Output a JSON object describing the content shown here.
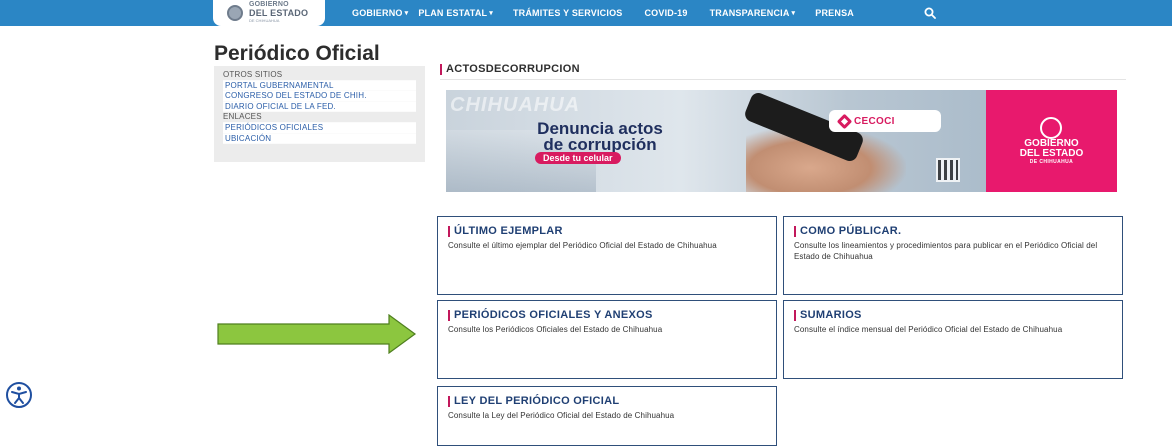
{
  "header": {
    "logo": {
      "line1": "GOBIERNO",
      "line2": "DEL ESTADO",
      "line3": "DE CHIHUAHUA"
    },
    "nav": [
      {
        "label": "GOBIERNO",
        "dropdown": true
      },
      {
        "label": "PLAN ESTATAL",
        "dropdown": true
      },
      {
        "label": "TRÁMITES Y SERVICIOS",
        "dropdown": false
      },
      {
        "label": "COVID-19",
        "dropdown": false
      },
      {
        "label": "TRANSPARENCIA",
        "dropdown": true
      },
      {
        "label": "PRENSA",
        "dropdown": false
      }
    ],
    "caret": "▾",
    "search_icon": "search-icon",
    "color": "#2b86c5"
  },
  "page_title": "Periódico Oficial",
  "sidebar": {
    "items": [
      {
        "label": "OTROS SITIOS",
        "type": "head"
      },
      {
        "label": "PORTAL GUBERNAMENTAL",
        "type": "link"
      },
      {
        "label": "CONGRESO DEL ESTADO DE CHIH.",
        "type": "link"
      },
      {
        "label": "DIARIO OFICIAL DE LA FED.",
        "type": "link"
      },
      {
        "label": "ENLACES",
        "type": "head"
      },
      {
        "label": "PERIÓDICOS OFICIALES",
        "type": "link"
      },
      {
        "label": "UBICACIÓN",
        "type": "link"
      }
    ]
  },
  "section_heading": "ACTOSDECORRUPCION",
  "banner": {
    "watermark": "CHIHUAHUA",
    "headline_1": "Denuncia actos",
    "headline_2": "de corrupción",
    "pill": "Desde tu celular",
    "brand": "CECOCI",
    "gov_line1": "GOBIERNO",
    "gov_line2": "DEL ESTADO",
    "gov_line3": "DE CHIHUAHUA",
    "accent": "#e8196d"
  },
  "cards": [
    {
      "title": "ÚLTIMO EJEMPLAR",
      "desc": "Consulte el último ejemplar del Periódico Oficial del Estado de Chihuahua"
    },
    {
      "title": "COMO PÚBLICAR.",
      "desc": "Consulte los lineamientos y procedimientos para publicar en el Periódico Oficial del Estado de Chihuahua"
    },
    {
      "title": "PERIÓDICOS OFICIALES Y ANEXOS",
      "desc": "Consulte los Periódicos Oficiales del Estado de Chihuahua"
    },
    {
      "title": "SUMARIOS",
      "desc": "Consulte el índice mensual del Periódico Oficial del Estado de Chihuahua"
    },
    {
      "title": "LEY DEL PERIÓDICO OFICIAL",
      "desc": "Consulte la Ley del Periódico Oficial del Estado de Chihuahua"
    }
  ],
  "annotation": {
    "icon": "green-arrow-right-icon",
    "color": "#8cc63f"
  },
  "accessibility": {
    "icon": "accessibility-icon",
    "color": "#1f4fa0"
  }
}
